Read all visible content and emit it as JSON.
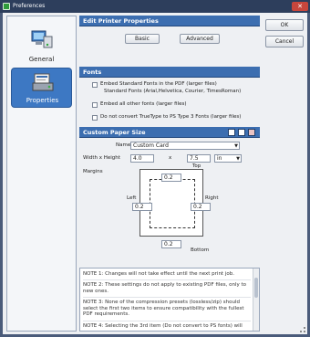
{
  "window": {
    "title": "Preferences"
  },
  "sidebar": {
    "items": [
      {
        "label": "General",
        "icon": "computer-icon"
      },
      {
        "label": "Properties",
        "icon": "printer-properties-icon"
      }
    ]
  },
  "buttons": {
    "ok": "OK",
    "cancel": "Cancel"
  },
  "edit_printer": {
    "title": "Edit Printer Properties",
    "basic": "Basic",
    "advanced": "Advanced"
  },
  "fonts": {
    "title": "Fonts",
    "embed_standard": "Embed Standard Fonts in the PDF (larger files)",
    "embed_standard_sub": "Standard Fonts (Arial,Helvetica, Courier, TimesRoman)",
    "embed_all": "Embed all other fonts (larger files)",
    "do_not_convert": "Do not convert TrueType to PS Type 3 Fonts (larger files)"
  },
  "custom_paper": {
    "title": "Custom Paper Size",
    "name_label": "Name",
    "name_value": "Custom Card",
    "width_height_label": "Width x Height",
    "width": "4.0",
    "x_symbol": "x",
    "height": "7.5",
    "unit": "in",
    "margins_label": "Margins",
    "top_label": "Top",
    "left_label": "Left",
    "right_label": "Right",
    "bottom_label": "Bottom",
    "margin_top": "0.2",
    "margin_left": "0.2",
    "margin_right": "0.2",
    "margin_bottom": "0.2"
  },
  "notes": [
    "NOTE 1: Changes will not take effect until the next print job.",
    "NOTE 2: These settings do not apply to existing PDF files, only to new ones.",
    "NOTE 3: None of the compression presets (lossless/zip) should select the first two items to ensure compatibility with the fullest PDF requirements.",
    "NOTE 4: Selecting the 3rd item (Do not convert to PS fonts) will"
  ],
  "colors": {
    "accent": "#3c6eb0",
    "titlebar": "#2d3e5c",
    "selected": "#3d78c3"
  }
}
